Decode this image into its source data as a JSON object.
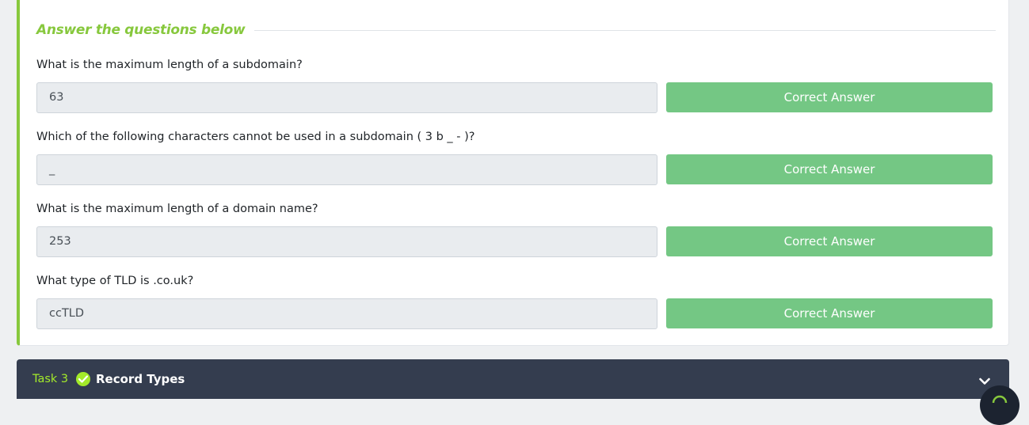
{
  "section": {
    "title": "Answer the questions below"
  },
  "questions": [
    {
      "label": "What is the maximum length of a subdomain?",
      "answer": "63",
      "button": "Correct Answer"
    },
    {
      "label": "Which of the following characters cannot be used in a subdomain ( 3 b _ - )?",
      "answer": "_",
      "button": "Correct Answer"
    },
    {
      "label": "What is the maximum length of a domain name?",
      "answer": "253",
      "button": "Correct Answer"
    },
    {
      "label": "What type of TLD is .co.uk?",
      "answer": "ccTLD",
      "button": "Correct Answer"
    }
  ],
  "next_task": {
    "number": "Task 3",
    "name": "Record Types",
    "status_icon": "check-circle-icon",
    "expand_icon": "chevron-down-icon"
  },
  "colors": {
    "accent": "#87c83d",
    "button": "#74c784",
    "taskbar": "#343d4f",
    "task_number": "#a3ea2a"
  }
}
